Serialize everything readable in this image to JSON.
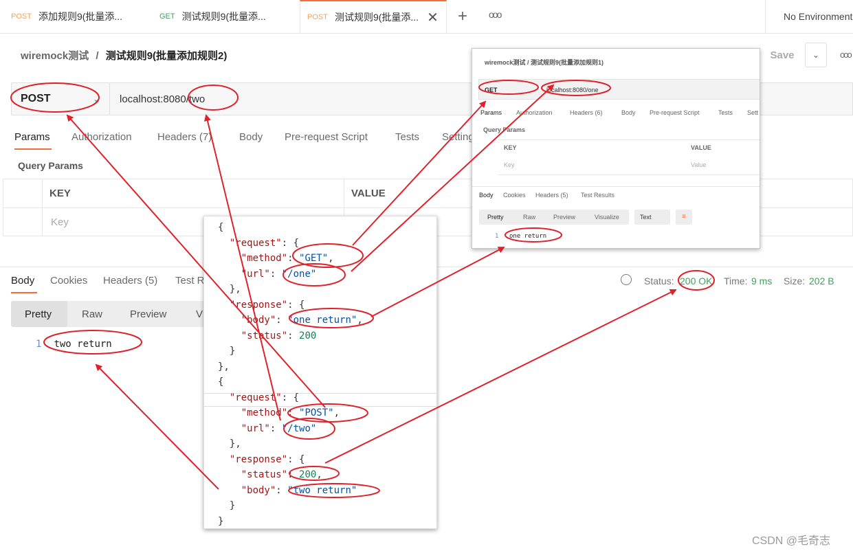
{
  "tabs": [
    {
      "method": "POST",
      "title": "添加规则9(批量添..."
    },
    {
      "method": "GET",
      "title": "测试规则9(批量添..."
    },
    {
      "method": "POST",
      "title": "测试规则9(批量添..."
    }
  ],
  "environment": "No Environment",
  "breadcrumb": {
    "parent": "wiremock测试",
    "sep": "/",
    "current": "测试规则9(批量添加规则2)"
  },
  "request": {
    "method": "POST",
    "url": "localhost:8080/two",
    "save": "Save"
  },
  "req_tabs": [
    "Params",
    "Authorization",
    "Headers (7)",
    "Body",
    "Pre-request Script",
    "Tests",
    "Setting"
  ],
  "query_params": {
    "title": "Query Params",
    "key": "KEY",
    "value": "VALUE",
    "key_ph": "Key"
  },
  "resp_tabs": [
    "Body",
    "Cookies",
    "Headers (5)",
    "Test R"
  ],
  "view_modes": [
    "Pretty",
    "Raw",
    "Preview",
    "V"
  ],
  "status": {
    "status_label": "Status:",
    "status_value": "200 OK",
    "time_label": "Time:",
    "time_value": "9 ms",
    "size_label": "Size:",
    "size_value": "202 B"
  },
  "response_body": {
    "line": "1",
    "text": "two return"
  },
  "code_lines": [
    {
      "t": "{"
    },
    {
      "t": "  \"request\": {"
    },
    {
      "t": "    \"method\": \"GET\","
    },
    {
      "t": "    \"url\": \"/one\""
    },
    {
      "t": "  },"
    },
    {
      "t": "  \"response\": {"
    },
    {
      "t": "    \"body\": \"one return\","
    },
    {
      "t": "    \"status\": 200"
    },
    {
      "t": "  }"
    },
    {
      "t": "},"
    },
    {
      "t": "{"
    },
    {
      "t": "  \"request\": {"
    },
    {
      "t": "    \"method\": \"POST\","
    },
    {
      "t": "    \"url\": \"/two\""
    },
    {
      "t": "  },"
    },
    {
      "t": "  \"response\": {"
    },
    {
      "t": "    \"status\": 200,"
    },
    {
      "t": "    \"body\": \"two return\""
    },
    {
      "t": "  }"
    },
    {
      "t": "}"
    }
  ],
  "mini": {
    "breadcrumb": "wiremock测试 / 测试规则9(批量添加规则1)",
    "method": "GET",
    "url": "localhost:8080/one",
    "tabs": [
      "Params",
      "Authorization",
      "Headers (6)",
      "Body",
      "Pre-request Script",
      "Tests",
      "Sett"
    ],
    "qp": "Query Params",
    "key": "KEY",
    "value": "VALUE",
    "key_ph": "Key",
    "value_ph": "Value",
    "resp_tabs": [
      "Body",
      "Cookies",
      "Headers (5)",
      "Test Results"
    ],
    "modes": [
      "Pretty",
      "Raw",
      "Preview",
      "Visualize",
      "Text"
    ],
    "line": "1",
    "body": "one return"
  },
  "watermark": "CSDN @毛奇志",
  "colors": {
    "accent": "#f26b3a",
    "annotation": "#e0202a",
    "status_ok": "#3da35a"
  }
}
